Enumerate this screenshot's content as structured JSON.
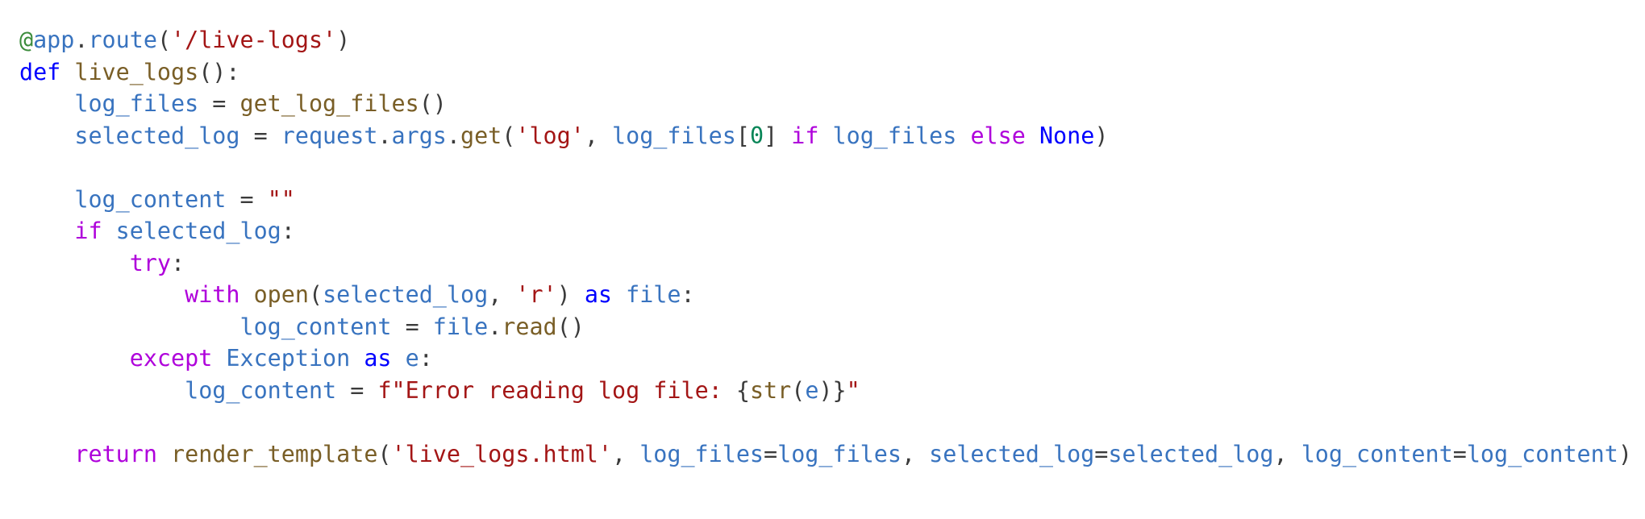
{
  "colors": {
    "default": "#3b3b3b",
    "keyword": "#0000ff",
    "control": "#af00db",
    "function": "#795e26",
    "variable": "#3873bf",
    "string": "#a31515",
    "number": "#098658",
    "decorator": "#3c8c3c"
  },
  "code": {
    "language": "python",
    "lines": [
      [
        {
          "t": "@",
          "k": "decorator"
        },
        {
          "t": "app",
          "k": "variable"
        },
        {
          "t": ".",
          "k": "default"
        },
        {
          "t": "route",
          "k": "variable"
        },
        {
          "t": "(",
          "k": "default"
        },
        {
          "t": "'/live-logs'",
          "k": "string"
        },
        {
          "t": ")",
          "k": "default"
        }
      ],
      [
        {
          "t": "def",
          "k": "keyword"
        },
        {
          "t": " ",
          "k": "default"
        },
        {
          "t": "live_logs",
          "k": "function"
        },
        {
          "t": "():",
          "k": "default"
        }
      ],
      [
        {
          "t": "    ",
          "k": "default"
        },
        {
          "t": "log_files",
          "k": "variable"
        },
        {
          "t": " = ",
          "k": "default"
        },
        {
          "t": "get_log_files",
          "k": "function"
        },
        {
          "t": "()",
          "k": "default"
        }
      ],
      [
        {
          "t": "    ",
          "k": "default"
        },
        {
          "t": "selected_log",
          "k": "variable"
        },
        {
          "t": " = ",
          "k": "default"
        },
        {
          "t": "request",
          "k": "variable"
        },
        {
          "t": ".",
          "k": "default"
        },
        {
          "t": "args",
          "k": "variable"
        },
        {
          "t": ".",
          "k": "default"
        },
        {
          "t": "get",
          "k": "function"
        },
        {
          "t": "(",
          "k": "default"
        },
        {
          "t": "'log'",
          "k": "string"
        },
        {
          "t": ", ",
          "k": "default"
        },
        {
          "t": "log_files",
          "k": "variable"
        },
        {
          "t": "[",
          "k": "default"
        },
        {
          "t": "0",
          "k": "number"
        },
        {
          "t": "] ",
          "k": "default"
        },
        {
          "t": "if",
          "k": "control"
        },
        {
          "t": " ",
          "k": "default"
        },
        {
          "t": "log_files",
          "k": "variable"
        },
        {
          "t": " ",
          "k": "default"
        },
        {
          "t": "else",
          "k": "control"
        },
        {
          "t": " ",
          "k": "default"
        },
        {
          "t": "None",
          "k": "keyword"
        },
        {
          "t": ")",
          "k": "default"
        }
      ],
      [],
      [
        {
          "t": "    ",
          "k": "default"
        },
        {
          "t": "log_content",
          "k": "variable"
        },
        {
          "t": " = ",
          "k": "default"
        },
        {
          "t": "\"\"",
          "k": "string"
        }
      ],
      [
        {
          "t": "    ",
          "k": "default"
        },
        {
          "t": "if",
          "k": "control"
        },
        {
          "t": " ",
          "k": "default"
        },
        {
          "t": "selected_log",
          "k": "variable"
        },
        {
          "t": ":",
          "k": "default"
        }
      ],
      [
        {
          "t": "        ",
          "k": "default"
        },
        {
          "t": "try",
          "k": "control"
        },
        {
          "t": ":",
          "k": "default"
        }
      ],
      [
        {
          "t": "            ",
          "k": "default"
        },
        {
          "t": "with",
          "k": "control"
        },
        {
          "t": " ",
          "k": "default"
        },
        {
          "t": "open",
          "k": "function"
        },
        {
          "t": "(",
          "k": "default"
        },
        {
          "t": "selected_log",
          "k": "variable"
        },
        {
          "t": ", ",
          "k": "default"
        },
        {
          "t": "'r'",
          "k": "string"
        },
        {
          "t": ") ",
          "k": "default"
        },
        {
          "t": "as",
          "k": "keyword"
        },
        {
          "t": " ",
          "k": "default"
        },
        {
          "t": "file",
          "k": "variable"
        },
        {
          "t": ":",
          "k": "default"
        }
      ],
      [
        {
          "t": "                ",
          "k": "default"
        },
        {
          "t": "log_content",
          "k": "variable"
        },
        {
          "t": " = ",
          "k": "default"
        },
        {
          "t": "file",
          "k": "variable"
        },
        {
          "t": ".",
          "k": "default"
        },
        {
          "t": "read",
          "k": "function"
        },
        {
          "t": "()",
          "k": "default"
        }
      ],
      [
        {
          "t": "        ",
          "k": "default"
        },
        {
          "t": "except",
          "k": "control"
        },
        {
          "t": " ",
          "k": "default"
        },
        {
          "t": "Exception",
          "k": "variable"
        },
        {
          "t": " ",
          "k": "default"
        },
        {
          "t": "as",
          "k": "keyword"
        },
        {
          "t": " ",
          "k": "default"
        },
        {
          "t": "e",
          "k": "variable"
        },
        {
          "t": ":",
          "k": "default"
        }
      ],
      [
        {
          "t": "            ",
          "k": "default"
        },
        {
          "t": "log_content",
          "k": "variable"
        },
        {
          "t": " = ",
          "k": "default"
        },
        {
          "t": "f\"Error reading log file: ",
          "k": "string"
        },
        {
          "t": "{",
          "k": "default"
        },
        {
          "t": "str",
          "k": "function"
        },
        {
          "t": "(",
          "k": "default"
        },
        {
          "t": "e",
          "k": "variable"
        },
        {
          "t": ")}",
          "k": "default"
        },
        {
          "t": "\"",
          "k": "string"
        }
      ],
      [],
      [
        {
          "t": "    ",
          "k": "default"
        },
        {
          "t": "return",
          "k": "control"
        },
        {
          "t": " ",
          "k": "default"
        },
        {
          "t": "render_template",
          "k": "function"
        },
        {
          "t": "(",
          "k": "default"
        },
        {
          "t": "'live_logs.html'",
          "k": "string"
        },
        {
          "t": ", ",
          "k": "default"
        },
        {
          "t": "log_files",
          "k": "variable"
        },
        {
          "t": "=",
          "k": "default"
        },
        {
          "t": "log_files",
          "k": "variable"
        },
        {
          "t": ", ",
          "k": "default"
        },
        {
          "t": "selected_log",
          "k": "variable"
        },
        {
          "t": "=",
          "k": "default"
        },
        {
          "t": "selected_log",
          "k": "variable"
        },
        {
          "t": ", ",
          "k": "default"
        },
        {
          "t": "log_content",
          "k": "variable"
        },
        {
          "t": "=",
          "k": "default"
        },
        {
          "t": "log_content",
          "k": "variable"
        },
        {
          "t": ")",
          "k": "default"
        }
      ]
    ]
  }
}
